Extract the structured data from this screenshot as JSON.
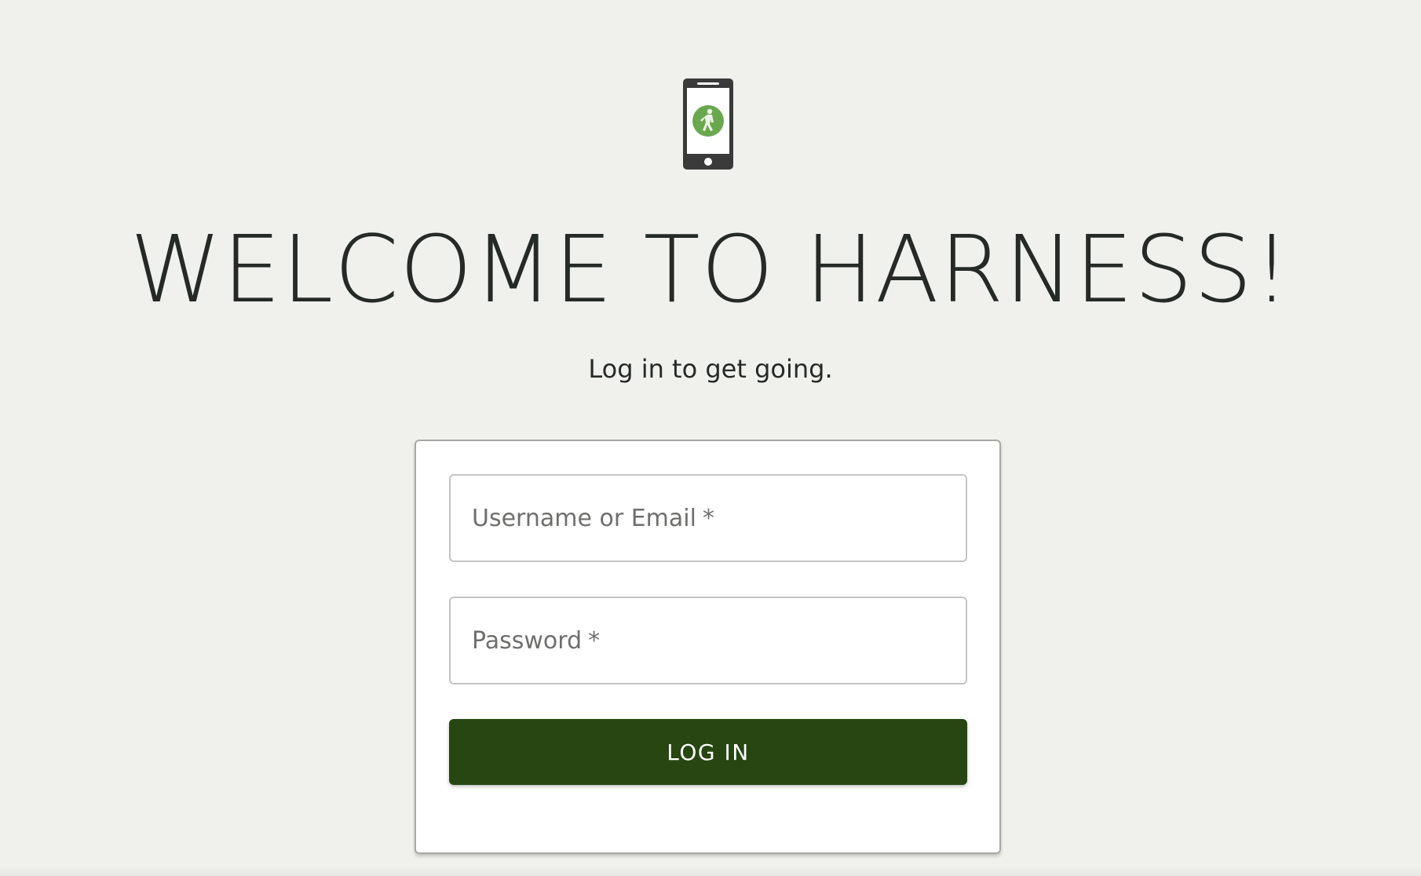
{
  "page": {
    "title": "WELCOME TO HARNESS!",
    "subtitle": "Log in to get going."
  },
  "logo": {
    "icon": "phone-with-worker-icon",
    "phone_color": "#3a3a3a",
    "badge_color": "#6aa84f"
  },
  "login_form": {
    "username": {
      "label": "Username or Email",
      "required_mark": "*",
      "value": ""
    },
    "password": {
      "label": "Password",
      "required_mark": "*",
      "value": ""
    },
    "submit_label": "LOG IN"
  },
  "colors": {
    "background": "#f0f1ec",
    "button": "#274612",
    "button_text": "#ffffff"
  }
}
